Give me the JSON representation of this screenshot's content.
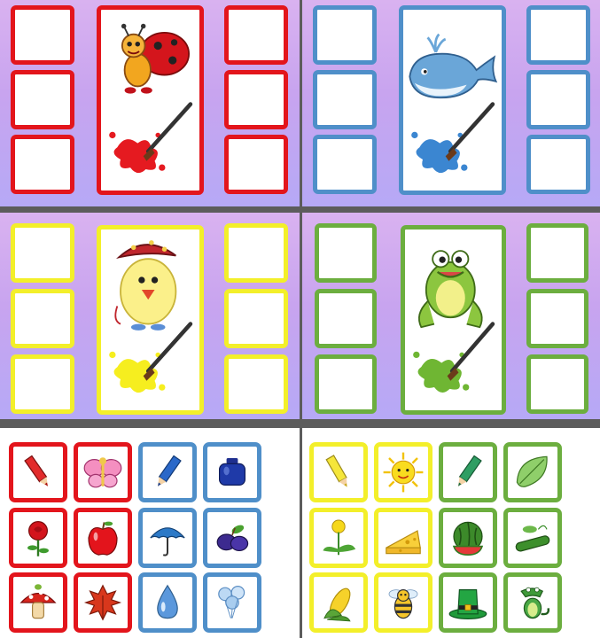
{
  "page": {
    "background": "#ffffff"
  },
  "colors": {
    "red": "#e3151c",
    "blue": "#4f8fc9",
    "yellow": "#f3ef2a",
    "green": "#6cae3f",
    "board_bg": "#c8a4ef",
    "divider": "#5c5c5c"
  },
  "boards": [
    {
      "id": "red-board",
      "color": "red",
      "character": "ladybug-icon",
      "paint": "red-paint-splash-icon",
      "empty_slots": 6
    },
    {
      "id": "blue-board",
      "color": "blue",
      "character": "whale-icon",
      "paint": "blue-paint-splash-icon",
      "empty_slots": 6
    },
    {
      "id": "yellow-board",
      "color": "yellow",
      "character": "chick-icon",
      "paint": "yellow-paint-splash-icon",
      "empty_slots": 6
    },
    {
      "id": "green-board",
      "color": "green",
      "character": "frog-icon",
      "paint": "green-paint-splash-icon",
      "empty_slots": 6
    }
  ],
  "card_sets": [
    {
      "id": "left-card-set",
      "cards": [
        {
          "icon": "red-pencil-icon",
          "color": "red"
        },
        {
          "icon": "butterfly-icon",
          "color": "red"
        },
        {
          "icon": "blue-pencil-icon",
          "color": "blue"
        },
        {
          "icon": "ink-jar-icon",
          "color": "blue"
        },
        {
          "icon": "rose-icon",
          "color": "red"
        },
        {
          "icon": "apple-icon",
          "color": "red"
        },
        {
          "icon": "umbrella-icon",
          "color": "blue"
        },
        {
          "icon": "plums-icon",
          "color": "blue"
        },
        {
          "icon": "mushroom-icon",
          "color": "red"
        },
        {
          "icon": "leaf-red-icon",
          "color": "red"
        },
        {
          "icon": "water-drop-icon",
          "color": "blue"
        },
        {
          "icon": "balloons-icon",
          "color": "blue"
        }
      ]
    },
    {
      "id": "right-card-set",
      "cards": [
        {
          "icon": "yellow-pencil-icon",
          "color": "yellow"
        },
        {
          "icon": "sun-icon",
          "color": "yellow"
        },
        {
          "icon": "green-pencil-icon",
          "color": "green"
        },
        {
          "icon": "leaf-green-icon",
          "color": "green"
        },
        {
          "icon": "dandelion-icon",
          "color": "yellow"
        },
        {
          "icon": "cheese-icon",
          "color": "yellow"
        },
        {
          "icon": "watermelon-icon",
          "color": "green"
        },
        {
          "icon": "cucumber-icon",
          "color": "green"
        },
        {
          "icon": "corn-icon",
          "color": "yellow"
        },
        {
          "icon": "bee-icon",
          "color": "yellow"
        },
        {
          "icon": "green-hat-icon",
          "color": "green"
        },
        {
          "icon": "crocodile-icon",
          "color": "green"
        }
      ]
    }
  ]
}
